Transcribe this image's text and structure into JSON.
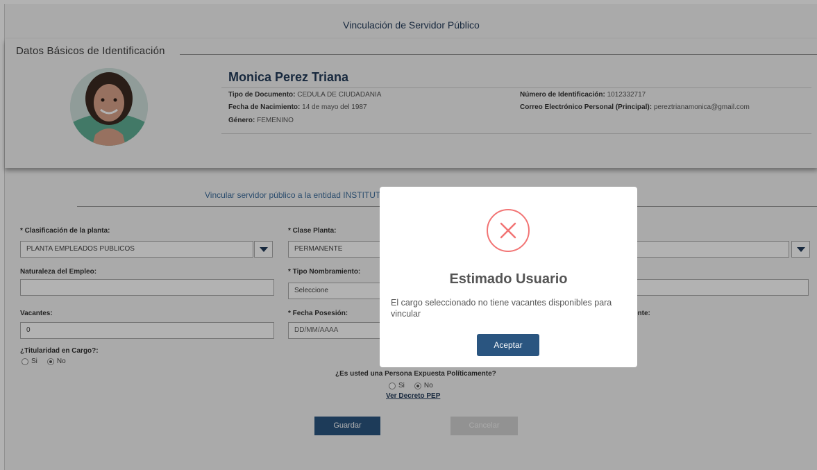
{
  "page": {
    "title": "Vinculación de Servidor Público"
  },
  "basic": {
    "legend": "Datos Básicos de Identificación",
    "name": "Monica Perez Triana",
    "doc_type_label": "Tipo de Documento:",
    "doc_type_value": "CEDULA DE CIUDADANIA",
    "birth_label": "Fecha de Nacimiento:",
    "birth_value": "14 de mayo del 1987",
    "gender_label": "Género:",
    "gender_value": "FEMENINO",
    "id_label": "Número de Identificación:",
    "id_value": "1012332717",
    "email_label": "Correo Electrónico Personal (Principal):",
    "email_value": "pereztrianamonica@gmail.com"
  },
  "form": {
    "subtitle": "Vincular servidor público a la entidad INSTITUTO",
    "clasificacion_label": "* Clasificación de la planta:",
    "clasificacion_value": "PLANTA EMPLEADOS PUBLICOS",
    "clase_label": "* Clase Planta:",
    "clase_value": "PERMANENTE",
    "naturaleza_label": "Naturaleza del Empleo:",
    "naturaleza_value": "",
    "tipo_label": "* Tipo Nombramiento:",
    "tipo_value": "Seleccione",
    "vacantes_label": "Vacantes:",
    "vacantes_value": "0",
    "fecha_label": "* Fecha Posesión:",
    "fecha_placeholder": "DD/MM/AAAA",
    "right_label_partial": "ente:",
    "titularidad_label": "¿Titularidad en Cargo?:",
    "si_label": "Si",
    "no_label": "No",
    "pep_question": "¿Es usted una Persona Expuesta Políticamente?",
    "pep_link": "Ver Decreto PEP",
    "save_label": "Guardar",
    "cancel_label": "Cancelar"
  },
  "modal": {
    "title": "Estimado Usuario",
    "message": "El cargo seleccionado no tiene vacantes disponibles para vincular",
    "accept_label": "Aceptar"
  },
  "colors": {
    "accent": "#2a5580",
    "primary_text": "#233b5a",
    "error": "#f27474"
  }
}
